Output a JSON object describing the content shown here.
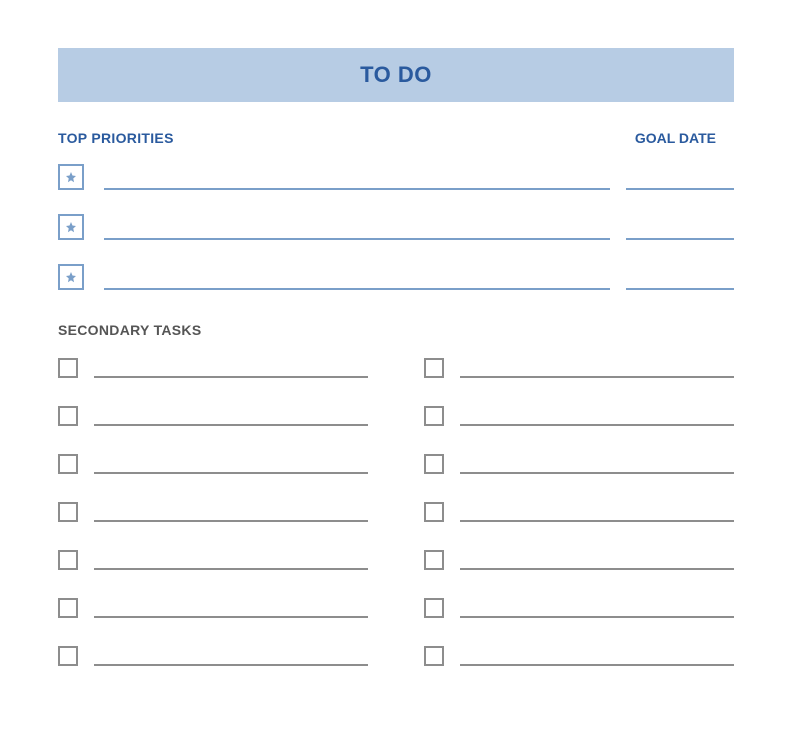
{
  "title": "TO DO",
  "headers": {
    "priorities": "TOP PRIORITIES",
    "goal_date": "GOAL DATE",
    "secondary": "SECONDARY TASKS"
  },
  "priorities": [
    {
      "task": "",
      "goal_date": ""
    },
    {
      "task": "",
      "goal_date": ""
    },
    {
      "task": "",
      "goal_date": ""
    }
  ],
  "secondary_left": [
    {
      "task": ""
    },
    {
      "task": ""
    },
    {
      "task": ""
    },
    {
      "task": ""
    },
    {
      "task": ""
    },
    {
      "task": ""
    },
    {
      "task": ""
    }
  ],
  "secondary_right": [
    {
      "task": ""
    },
    {
      "task": ""
    },
    {
      "task": ""
    },
    {
      "task": ""
    },
    {
      "task": ""
    },
    {
      "task": ""
    },
    {
      "task": ""
    }
  ]
}
